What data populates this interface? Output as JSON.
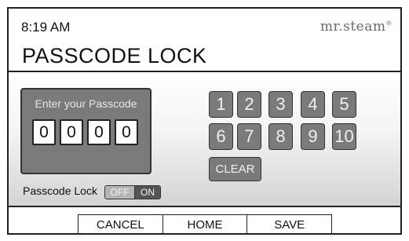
{
  "header": {
    "time": "8:19 AM",
    "brand": "mr.steam",
    "brand_mark": "®",
    "title": "PASSCODE LOCK"
  },
  "passcode": {
    "prompt": "Enter your Passcode",
    "digits": [
      "0",
      "0",
      "0",
      "0"
    ]
  },
  "lock_toggle": {
    "label": "Passcode Lock",
    "off_label": "OFF",
    "on_label": "ON",
    "selected": "ON"
  },
  "keypad": {
    "keys": [
      "1",
      "2",
      "3",
      "4",
      "5",
      "6",
      "7",
      "8",
      "9",
      "10"
    ],
    "clear_label": "CLEAR"
  },
  "nav": {
    "cancel_label": "CANCEL",
    "home_label": "HOME",
    "save_label": "SAVE"
  },
  "colors": {
    "panel_gray": "#7a7a7a",
    "toggle_on": "#555555",
    "toggle_off": "#b5b5b5",
    "border": "#222222"
  }
}
